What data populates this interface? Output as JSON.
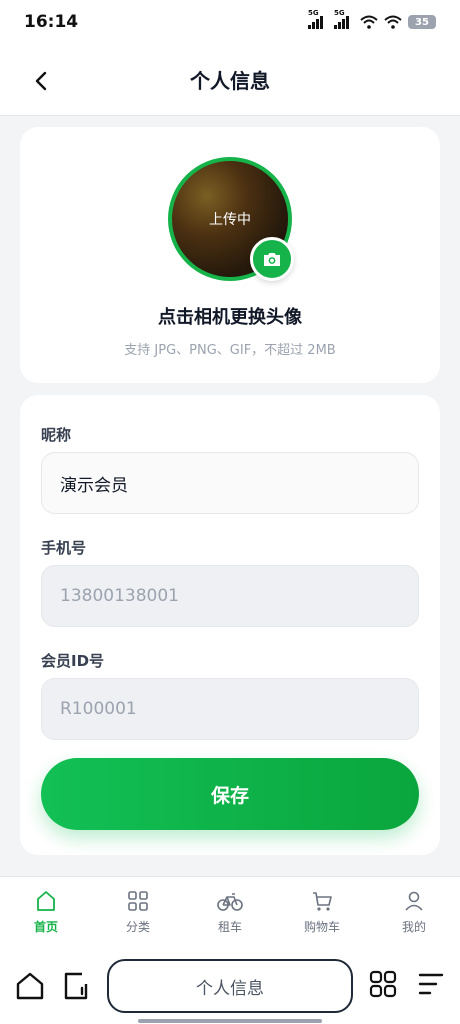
{
  "status_bar": {
    "time": "16:14",
    "signal_label": "5G",
    "battery": "35"
  },
  "header": {
    "title": "个人信息",
    "back_icon": "chevron-left-icon"
  },
  "avatar": {
    "uploading_text": "上传中",
    "title": "点击相机更换头像",
    "hint": "支持 JPG、PNG、GIF，不超过 2MB",
    "camera_icon": "camera-icon"
  },
  "form": {
    "nickname_label": "昵称",
    "nickname_value": "演示会员",
    "phone_label": "手机号",
    "phone_value": "13800138001",
    "member_id_label": "会员ID号",
    "member_id_value": "R100001",
    "save_label": "保存"
  },
  "tabs": [
    {
      "label": "首页",
      "icon": "home-icon",
      "active": true
    },
    {
      "label": "分类",
      "icon": "grid-icon",
      "active": false
    },
    {
      "label": "租车",
      "icon": "bicycle-icon",
      "active": false
    },
    {
      "label": "购物车",
      "icon": "cart-icon",
      "active": false
    },
    {
      "label": "我的",
      "icon": "user-icon",
      "active": false
    }
  ],
  "system_nav": {
    "title": "个人信息"
  },
  "colors": {
    "accent": "#16b34a",
    "inactive": "#6b7280"
  }
}
